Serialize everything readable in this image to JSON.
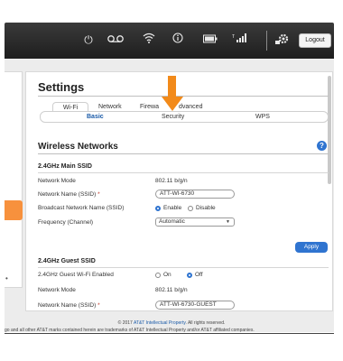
{
  "toolbar": {
    "icons": [
      "power-icon",
      "voicemail-icon",
      "wifi-icon",
      "info-icon",
      "battery-icon",
      "signal-icon",
      "settings-gear-icon"
    ],
    "signal_label": "4G LTE",
    "logout_label": "Logout"
  },
  "settings": {
    "title": "Settings",
    "tabs": [
      "Wi-Fi",
      "Network",
      "Firewall",
      "Advanced"
    ],
    "firewall_visible": "Firewa",
    "advanced_visible": "dvanced",
    "subtabs": [
      "Basic",
      "Security",
      "WPS"
    ],
    "section_title": "Wireless Networks",
    "help_symbol": "?"
  },
  "main_ssid": {
    "title": "2.4GHz Main SSID",
    "network_mode_label": "Network Mode",
    "network_mode_value": "802.11 b/g/n",
    "network_name_label": "Network Name (SSID)",
    "network_name_value": "ATT-WI-6730",
    "broadcast_label": "Broadcast Network Name (SSID)",
    "broadcast_enable": "Enable",
    "broadcast_disable": "Disable",
    "frequency_label": "Frequency (Channel)",
    "frequency_value": "Automatic"
  },
  "apply_label": "Apply",
  "guest_ssid": {
    "title": "2.4GHz Guest SSID",
    "enabled_label": "2.4GHz Guest Wi-Fi Enabled",
    "on_label": "On",
    "off_label": "Off",
    "network_mode_label": "Network Mode",
    "network_mode_value": "802.11 b/g/n",
    "network_name_label": "Network Name (SSID)",
    "network_name_value": "ATT-WI-6730-GUEST"
  },
  "required_mark": "*",
  "footer": {
    "line1_prefix": "© 2017 ",
    "line1_link": "AT&T Intellectual Property",
    "line1_suffix": ". All rights reserved.",
    "line2": "go and all other AT&T marks contained herein are trademarks of AT&T Intellectual Property and/or AT&T affiliated companies."
  },
  "colors": {
    "accent": "#2f74d0",
    "highlight": "#f28a1a",
    "toolbar": "#2a2a2a"
  }
}
